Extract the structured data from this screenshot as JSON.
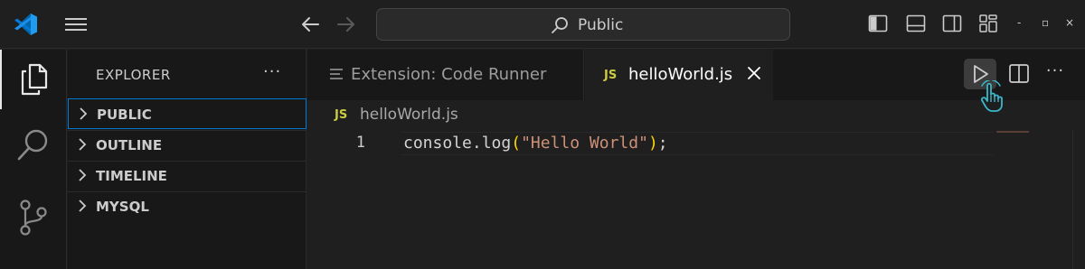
{
  "titlebar": {
    "search_text": "Public",
    "window_controls": [
      "-",
      "▫",
      "×"
    ],
    "icons": [
      "vscode-logo-icon",
      "menu-icon",
      "back-arrow-icon",
      "forward-arrow-icon",
      "search-icon",
      "toggle-primary-sidebar-icon",
      "toggle-panel-icon",
      "toggle-secondary-sidebar-icon",
      "customize-layout-icon"
    ]
  },
  "activity_bar": {
    "items": [
      {
        "name": "explorer",
        "icon": "files-icon",
        "active": true
      },
      {
        "name": "search",
        "icon": "search-icon",
        "active": false
      },
      {
        "name": "source-control",
        "icon": "source-control-icon",
        "active": false
      }
    ]
  },
  "sidebar": {
    "title": "EXPLORER",
    "more": "···",
    "sections": [
      {
        "label": "PUBLIC",
        "focused": true
      },
      {
        "label": "OUTLINE",
        "focused": false
      },
      {
        "label": "TIMELINE",
        "focused": false
      },
      {
        "label": "MYSQL",
        "focused": false
      }
    ]
  },
  "editor": {
    "tabs": [
      {
        "label": "Extension: Code Runner",
        "icon": "lines-icon",
        "active": false
      },
      {
        "label": "helloWorld.js",
        "badge": "JS",
        "active": true
      }
    ],
    "actions": {
      "run": "play-icon",
      "split": "split-editor-icon",
      "more": "···"
    },
    "breadcrumb": {
      "badge": "JS",
      "label": "helloWorld.js"
    },
    "lines": [
      {
        "number": "1",
        "prefix": "console.log",
        "open": "(",
        "string": "\"Hello World\"",
        "close": ")",
        "suffix": ";"
      }
    ]
  },
  "colors": {
    "accent": "#0078d4",
    "js_badge": "#cbcb41",
    "string": "#ce9178",
    "bracket": "#ffd700",
    "logo": "#2489ca",
    "cursor": "#3ab7c9"
  }
}
